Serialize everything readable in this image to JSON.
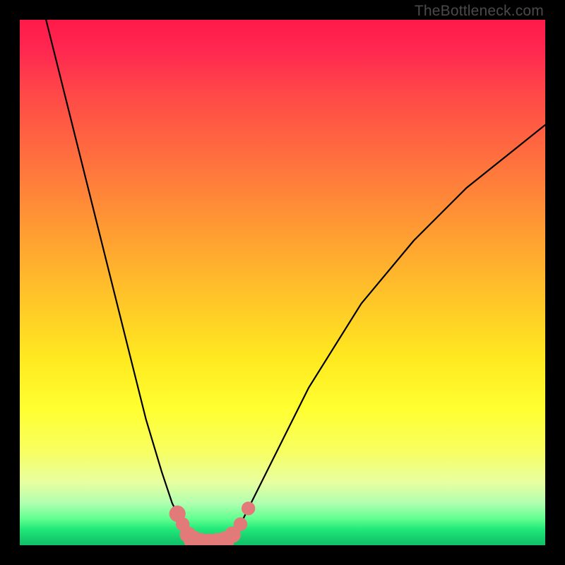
{
  "watermark": "TheBottleneck.com",
  "chart_data": {
    "type": "line",
    "title": "",
    "xlabel": "",
    "ylabel": "",
    "xlim": [
      0,
      100
    ],
    "ylim": [
      0,
      100
    ],
    "series": [
      {
        "name": "left-branch",
        "x": [
          5,
          10,
          15,
          20,
          24,
          27,
          29,
          30,
          31,
          32,
          33
        ],
        "y": [
          100,
          80,
          60,
          40,
          24,
          14,
          8,
          6,
          4,
          2,
          1
        ]
      },
      {
        "name": "right-branch",
        "x": [
          40,
          42,
          44,
          48,
          55,
          65,
          75,
          85,
          95,
          100
        ],
        "y": [
          1,
          4,
          8,
          16,
          30,
          46,
          58,
          68,
          76,
          80
        ]
      },
      {
        "name": "floor",
        "x": [
          33,
          34,
          36,
          38,
          40
        ],
        "y": [
          1,
          0.5,
          0.4,
          0.5,
          1
        ]
      }
    ],
    "markers": [
      {
        "x": 30,
        "y": 6,
        "r": 1.2
      },
      {
        "x": 31,
        "y": 4,
        "r": 1.0
      },
      {
        "x": 32,
        "y": 2,
        "r": 1.2
      },
      {
        "x": 33,
        "y": 1,
        "r": 1.4
      },
      {
        "x": 34.5,
        "y": 0.5,
        "r": 1.4
      },
      {
        "x": 36,
        "y": 0.4,
        "r": 1.4
      },
      {
        "x": 37.5,
        "y": 0.5,
        "r": 1.4
      },
      {
        "x": 39,
        "y": 0.8,
        "r": 1.4
      },
      {
        "x": 40.5,
        "y": 2,
        "r": 1.2
      },
      {
        "x": 42,
        "y": 4,
        "r": 1.0
      },
      {
        "x": 43.5,
        "y": 7,
        "r": 1.0
      }
    ],
    "colors": {
      "curve": "#000000",
      "marker": "#e27a7a"
    }
  }
}
